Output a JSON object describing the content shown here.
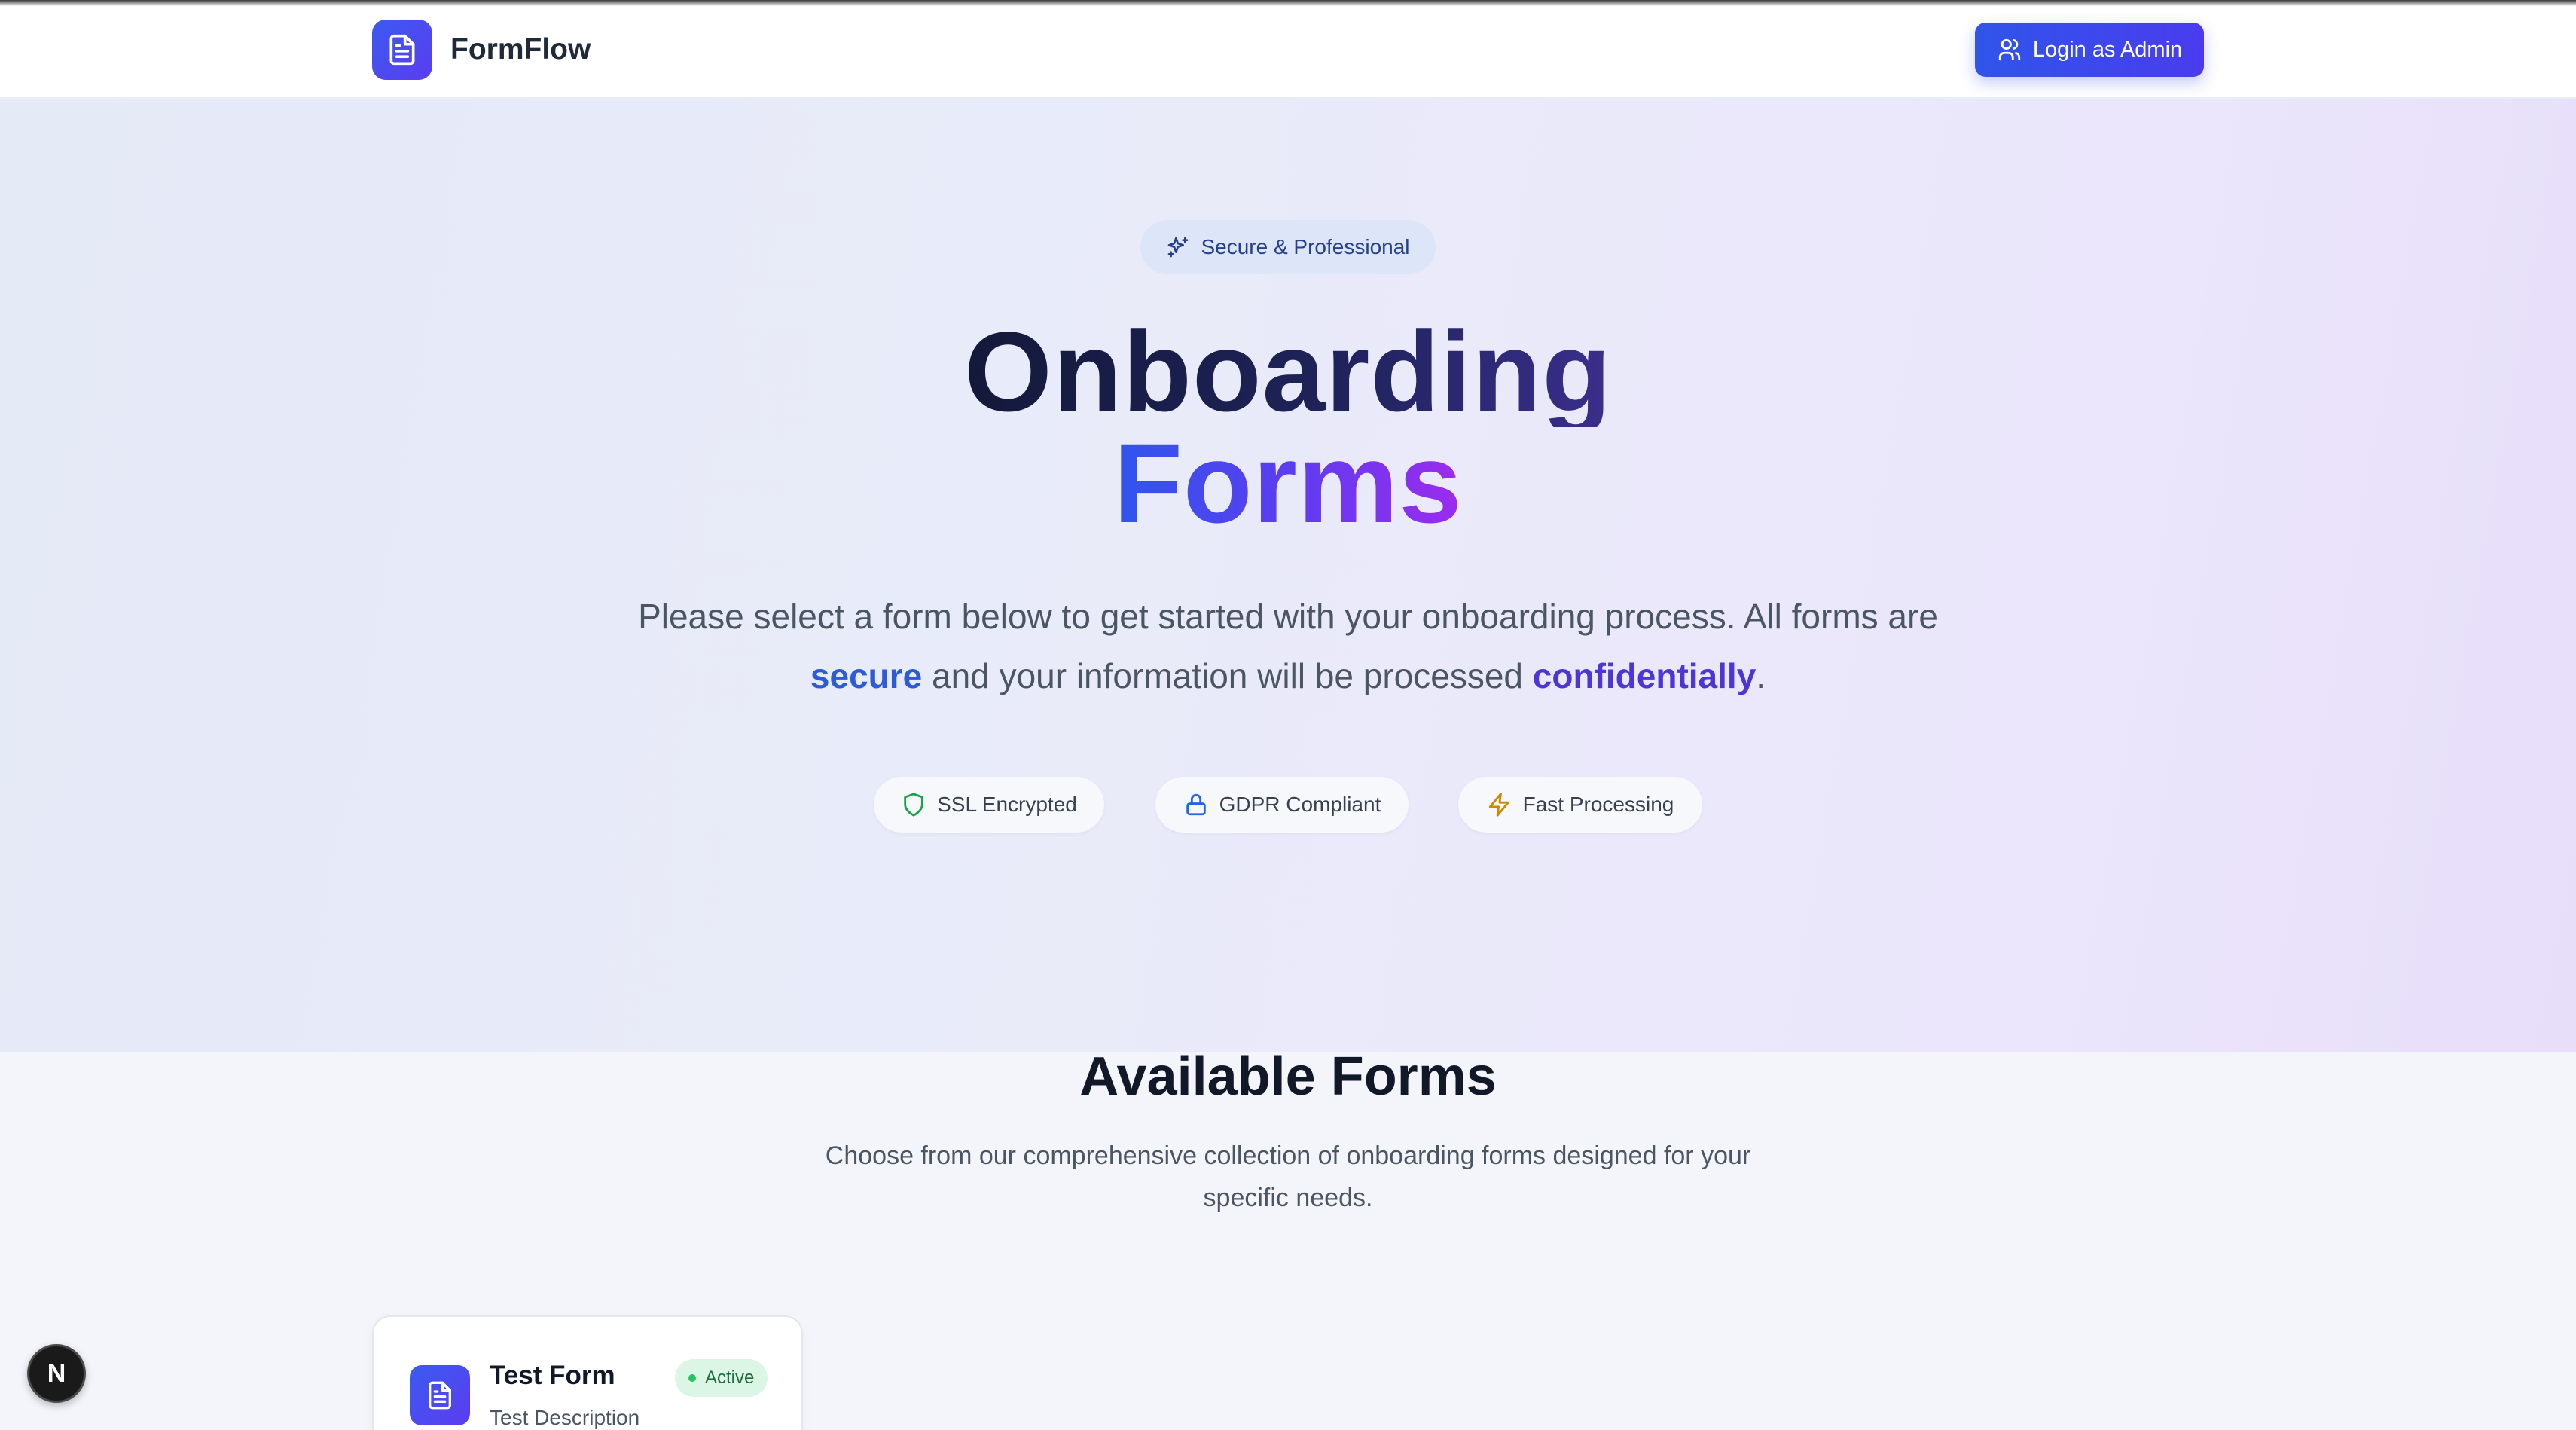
{
  "header": {
    "brand_name": "FormFlow",
    "login_label": "Login as Admin"
  },
  "hero": {
    "badge": "Secure & Professional",
    "title_line1": "Onboarding",
    "title_line2": "Forms",
    "subtitle_part1": "Please select a form below to get started with your onboarding process. All forms are ",
    "subtitle_highlight1": "secure",
    "subtitle_part2": " and your information will be processed ",
    "subtitle_highlight2": "confidentially",
    "subtitle_part3": ".",
    "features": [
      {
        "label": "SSL Encrypted",
        "icon": "shield-icon",
        "color": "#16a34a"
      },
      {
        "label": "GDPR Compliant",
        "icon": "lock-icon",
        "color": "#2563eb"
      },
      {
        "label": "Fast Processing",
        "icon": "lightning-icon",
        "color": "#ca8a04"
      }
    ]
  },
  "forms_section": {
    "title": "Available Forms",
    "subtitle": "Choose from our comprehensive collection of onboarding forms designed for your specific needs.",
    "cards": [
      {
        "title": "Test Form",
        "description": "Test Description",
        "status": "Active"
      }
    ]
  },
  "dev_indicator": {
    "label": "N"
  },
  "colors": {
    "accent": "#3b4fea",
    "accent_purple": "#9d2bee",
    "active_green": "#22c55e"
  }
}
